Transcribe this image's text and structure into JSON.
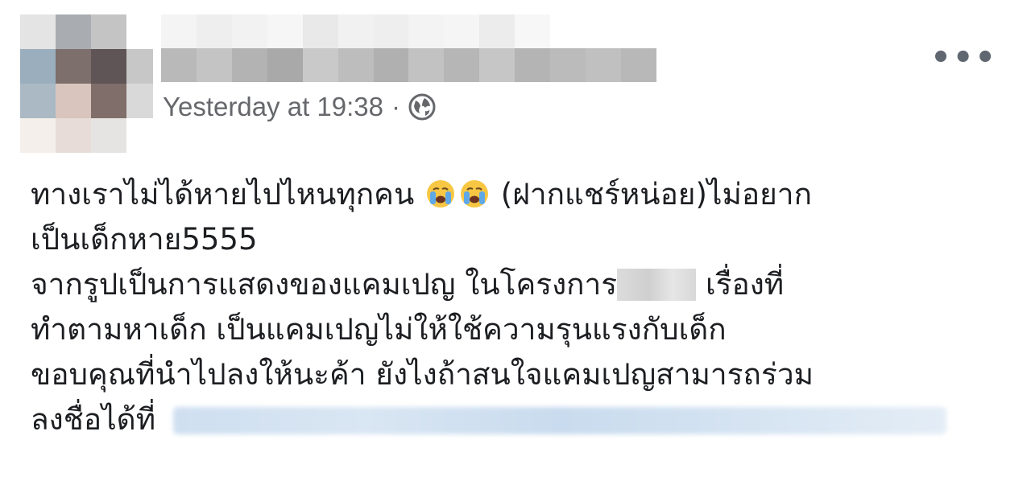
{
  "post": {
    "timestamp": "Yesterday at 19:38",
    "separator": "·",
    "privacy_icon": "globe-icon",
    "more_label": "•••",
    "lines": {
      "l1_a": "ทางเราไม่ได้หายไปไหนทุกคน",
      "l1_b": "(ฝากแชร์หน่อย)ไม่อยาก",
      "l2": "เป็นเด็กหาย5555",
      "l3_a": "จากรูปเป็นการแสดงของแคมเปญ ในโครงการ",
      "l3_b": "เรื่องที่",
      "l4": "ทำตามหาเด็ก เป็นแคมเปญไม่ให้ใช้ความรุนแรงกับเด็ก",
      "l5": "ขอบคุณที่นำไปลงให้นะค้า ยังไงถ้าสนใจแคมเปญสามารถร่วม",
      "l6": "ลงชื่อได้ที่"
    },
    "emoji": [
      "loudly-crying-face-icon",
      "loudly-crying-face-icon"
    ]
  },
  "colors": {
    "meta_text": "#65676b",
    "body_text": "#1c1e21",
    "emoji_face": "#f7c744",
    "emoji_tears": "#5fa8e8"
  }
}
